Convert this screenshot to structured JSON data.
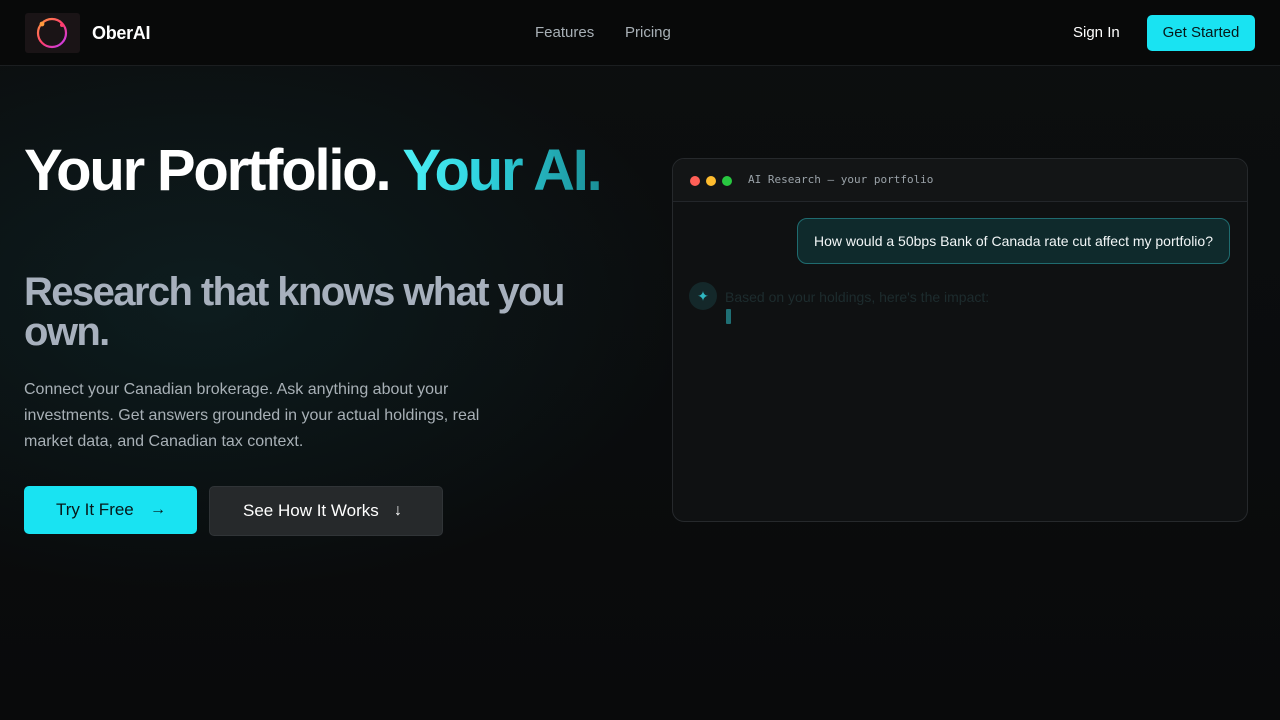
{
  "nav": {
    "brand": "OberAI",
    "links": [
      {
        "label": "Features"
      },
      {
        "label": "Pricing"
      }
    ],
    "signin_label": "Sign In",
    "cta_label": "Get Started"
  },
  "hero": {
    "headline_part1": "Your Portfolio. ",
    "headline_accent": "Your AI.",
    "subheadline": "Research that knows what you own.",
    "description": "Connect your Canadian brokerage. Ask anything about your investments. Get answers grounded in your actual holdings, real market data, and Canadian tax context.",
    "primary_button": {
      "label": "Try It Free",
      "icon": "arrow-right-icon"
    },
    "secondary_button": {
      "label": "See How It Works",
      "icon": "arrow-down-icon"
    }
  },
  "chat_window": {
    "title": "AI Research — your portfolio",
    "user_message": "How would a 50bps Bank of Canada rate cut affect my portfolio?",
    "assistant_avatar_icon": "sparkle-icon",
    "assistant_message": "Based on your holdings, here's the impact:"
  },
  "colors": {
    "accent": "#19e3f2",
    "background": "#0b0c0d",
    "user_bubble": "#0f2a2c",
    "user_bubble_border": "#1f6b6f"
  }
}
